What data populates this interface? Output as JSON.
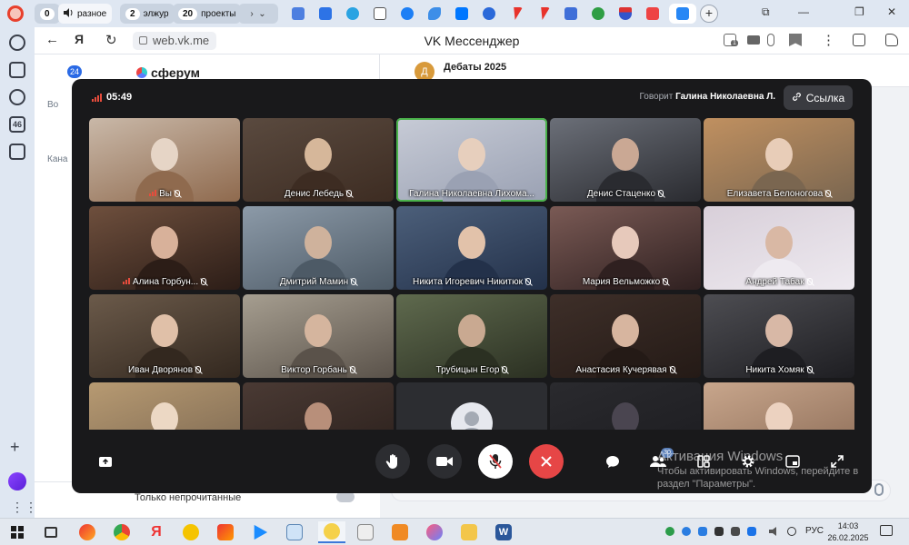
{
  "browser": {
    "tab_groups": [
      {
        "count": "0",
        "label": ""
      },
      {
        "count": "",
        "label": "разное",
        "active": true
      },
      {
        "count": "2",
        "label": "элжур"
      },
      {
        "count": "20",
        "label": "проекты"
      }
    ],
    "address": {
      "url": "web.vk.me",
      "page_title": "VK Мессенджер"
    },
    "toolbar_badge": "1"
  },
  "sidebar": {
    "badge_46": "46"
  },
  "vk": {
    "logo_text": "сферум",
    "unread_count": "24",
    "left_cut_1": "Во",
    "left_cut_2": "Кана",
    "chat_avatar_letter": "Д",
    "chat_name": "Дебаты 2025",
    "only_unread_label": "Только непрочитанные"
  },
  "call": {
    "timer": "05:49",
    "speaking_prefix": "Говорит",
    "speaking_name": "Галина Николаевна Л.",
    "link_label": "Ссылка",
    "participants_badge": "30",
    "participants": [
      {
        "name": "Вы",
        "muted": true,
        "speaking_signal": true
      },
      {
        "name": "Денис Лебедь",
        "muted": true
      },
      {
        "name": "Галина Николаевна Лихома...",
        "muted": false,
        "active_speaker": true
      },
      {
        "name": "Денис Стаценко",
        "muted": true
      },
      {
        "name": "Елизавета Белоногова",
        "muted": true
      },
      {
        "name": "Алина Горбун...",
        "muted": true,
        "speaking_signal": true
      },
      {
        "name": "Дмитрий Мамин",
        "muted": true
      },
      {
        "name": "Никита Игоревич Никитюк",
        "muted": true
      },
      {
        "name": "Мария Вельможко",
        "muted": true
      },
      {
        "name": "Андрей Табак",
        "muted": true
      },
      {
        "name": "Иван Дворянов",
        "muted": true
      },
      {
        "name": "Виктор Горбань",
        "muted": true
      },
      {
        "name": "Трубицын Егор",
        "muted": true
      },
      {
        "name": "Анастасия Кучерявая",
        "muted": true
      },
      {
        "name": "Никита Хомяк",
        "muted": true
      },
      {
        "name": "",
        "muted": false
      },
      {
        "name": "",
        "muted": false
      },
      {
        "name": "",
        "muted": false,
        "placeholder_avatar": true
      },
      {
        "name": "",
        "muted": false
      },
      {
        "name": "",
        "muted": false
      }
    ],
    "controls": [
      "screen-share",
      "raise-hand",
      "camera",
      "microphone-off",
      "end-call",
      "chat",
      "participants",
      "layout",
      "settings",
      "fullscreen"
    ]
  },
  "watermark": {
    "line1": "Активация Windows",
    "line2": "Чтобы активировать Windows, перейдите в",
    "line3": "раздел \"Параметры\"."
  },
  "taskbar": {
    "lang": "РУС",
    "time": "14:03",
    "date": "26.02.2025"
  },
  "colors": {
    "call_bg": "#19191b",
    "end_call": "#e64646",
    "speaker_border": "#4bb34b",
    "vk_accent": "#2a6ae5"
  }
}
